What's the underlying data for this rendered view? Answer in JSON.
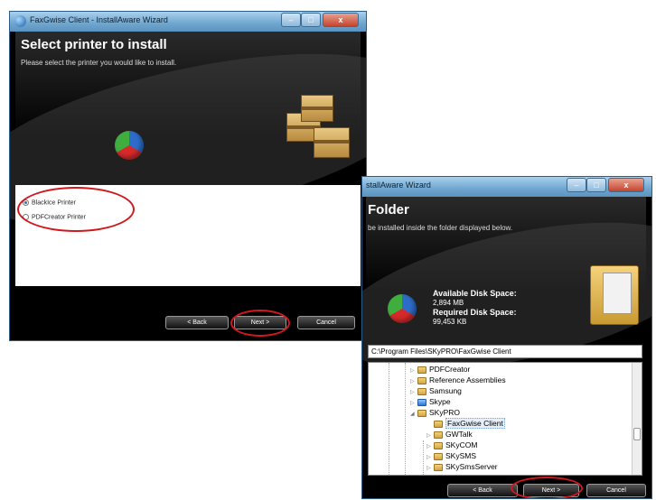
{
  "win1": {
    "title": "FaxGwise Client - InstallAware Wizard",
    "heading": "Select printer to install",
    "subtitle": "Please select the printer you would like to install.",
    "options": [
      {
        "label": "BlackIce Printer",
        "selected": true
      },
      {
        "label": "PDFCreator Printer",
        "selected": false
      }
    ],
    "buttons": {
      "back": "< Back",
      "next": "Next >",
      "cancel": "Cancel"
    },
    "controls": {
      "min": "–",
      "max": "□",
      "close": "x"
    }
  },
  "win2": {
    "title": "stallAware Wizard",
    "heading": "Folder",
    "subtitle": "be installed inside the folder displayed below.",
    "disk": {
      "available_label": "Available Disk Space:",
      "available_value": "2,894 MB",
      "required_label": "Required Disk Space:",
      "required_value": "99,453 KB"
    },
    "path": "C:\\Program Files\\SKyPRO\\FaxGwise Client",
    "tree": [
      {
        "label": "PDFCreator",
        "expander": "▷",
        "icon": "folder-icon",
        "indent": 0
      },
      {
        "label": "Reference Assemblies",
        "expander": "▷",
        "icon": "folder-icon",
        "indent": 0
      },
      {
        "label": "Samsung",
        "expander": "▷",
        "icon": "folder-icon",
        "indent": 0
      },
      {
        "label": "Skype",
        "expander": "▷",
        "icon": "skype-folder-icon",
        "indent": 0
      },
      {
        "label": "SKyPRO",
        "expander": "◢",
        "icon": "folder-icon",
        "indent": 0
      },
      {
        "label": "FaxGwise Client",
        "expander": "",
        "icon": "folder-icon",
        "indent": 1,
        "selected": true
      },
      {
        "label": "GWTalk",
        "expander": "▷",
        "icon": "folder-icon",
        "indent": 1
      },
      {
        "label": "SKyCOM",
        "expander": "▷",
        "icon": "folder-icon",
        "indent": 1
      },
      {
        "label": "SKySMS",
        "expander": "▷",
        "icon": "folder-icon",
        "indent": 1
      },
      {
        "label": "SKySmsServer",
        "expander": "▷",
        "icon": "folder-icon",
        "indent": 1
      }
    ],
    "buttons": {
      "back": "< Back",
      "next": "Next >",
      "cancel": "Cancel"
    },
    "controls": {
      "min": "–",
      "max": "□",
      "close": "x"
    }
  },
  "colors": {
    "annotation": "#d0181f",
    "titlebar": "#6fa6cf"
  }
}
